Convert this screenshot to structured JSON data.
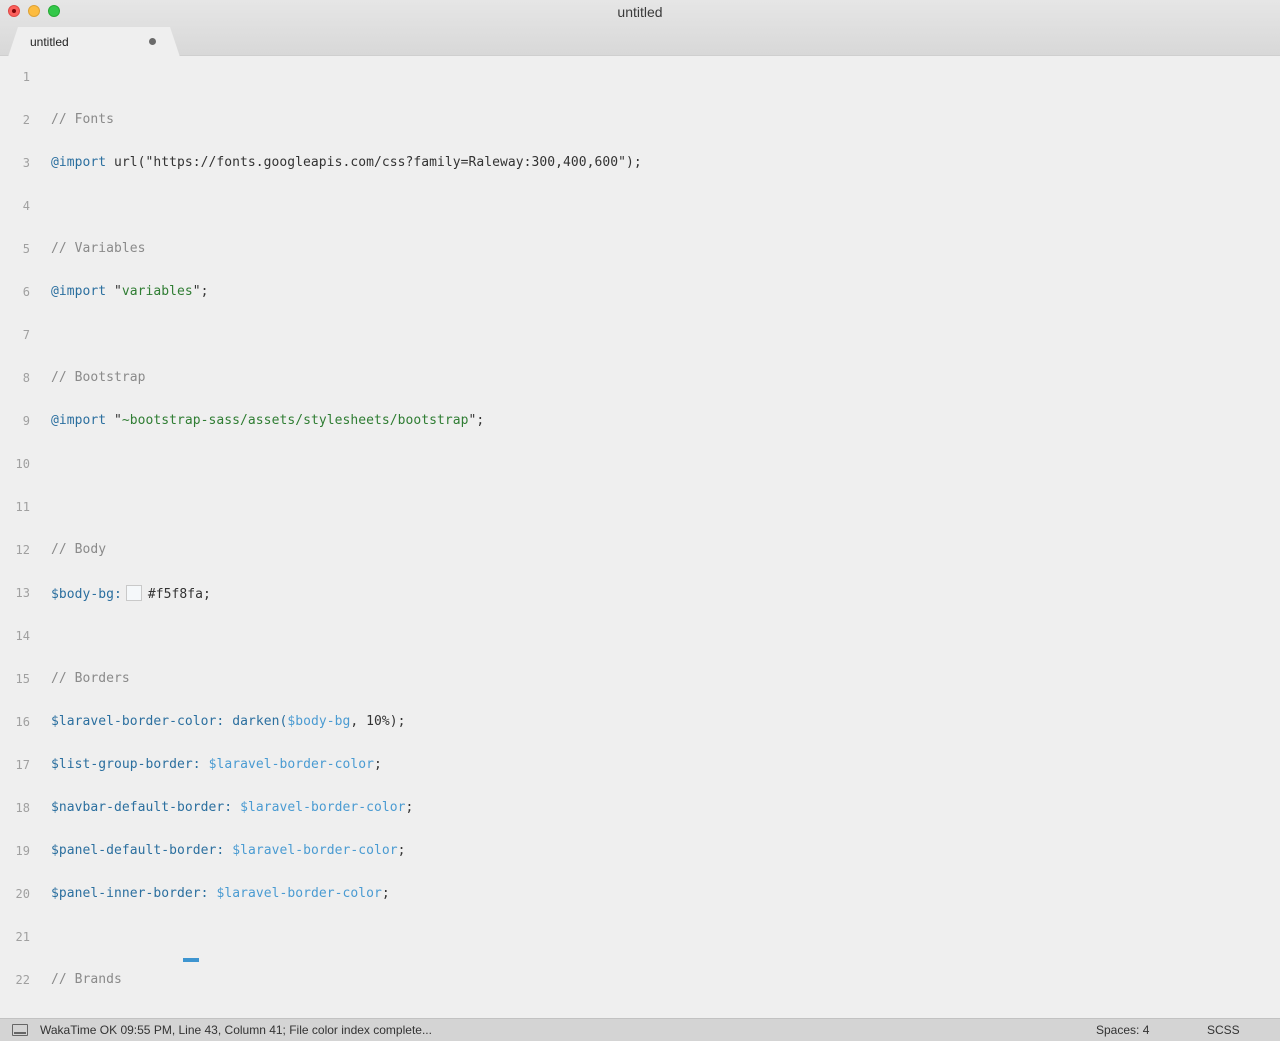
{
  "window": {
    "title": "untitled"
  },
  "tab": {
    "label": "untitled"
  },
  "editor": {
    "lines": [
      {
        "num": "1",
        "tokens": []
      },
      {
        "num": "2",
        "tokens": [
          {
            "t": "comment",
            "v": "// Fonts"
          }
        ]
      },
      {
        "num": "3",
        "tokens": [
          {
            "t": "at",
            "v": "@import"
          },
          {
            "t": "plain",
            "v": " url(\"https://fonts.googleapis.com/css?family=Raleway:300,400,600\");"
          }
        ]
      },
      {
        "num": "4",
        "tokens": []
      },
      {
        "num": "5",
        "tokens": [
          {
            "t": "comment",
            "v": "// Variables"
          }
        ]
      },
      {
        "num": "6",
        "tokens": [
          {
            "t": "at",
            "v": "@import"
          },
          {
            "t": "plain",
            "v": " \""
          },
          {
            "t": "str",
            "v": "variables"
          },
          {
            "t": "plain",
            "v": "\";"
          }
        ]
      },
      {
        "num": "7",
        "tokens": []
      },
      {
        "num": "8",
        "tokens": [
          {
            "t": "comment",
            "v": "// Bootstrap"
          }
        ]
      },
      {
        "num": "9",
        "tokens": [
          {
            "t": "at",
            "v": "@import"
          },
          {
            "t": "plain",
            "v": " \""
          },
          {
            "t": "str",
            "v": "~bootstrap-sass/assets/stylesheets/bootstrap"
          },
          {
            "t": "plain",
            "v": "\";"
          }
        ]
      },
      {
        "num": "10",
        "tokens": []
      },
      {
        "num": "11",
        "tokens": []
      },
      {
        "num": "12",
        "tokens": [
          {
            "t": "comment",
            "v": "// Body"
          }
        ]
      },
      {
        "num": "13",
        "tokens": [
          {
            "t": "var",
            "v": "$body-bg:"
          },
          {
            "t": "swatch",
            "v": "#f5f8fa"
          },
          {
            "t": "plain",
            "v": "#f5f8fa;"
          }
        ]
      },
      {
        "num": "14",
        "tokens": []
      },
      {
        "num": "15",
        "tokens": [
          {
            "t": "comment",
            "v": "// Borders"
          }
        ]
      },
      {
        "num": "16",
        "tokens": [
          {
            "t": "var",
            "v": "$laravel-border-color:"
          },
          {
            "t": "plain",
            "v": " "
          },
          {
            "t": "fn",
            "v": "darken("
          },
          {
            "t": "varref",
            "v": "$body-bg"
          },
          {
            "t": "plain",
            "v": ", 10%);"
          }
        ]
      },
      {
        "num": "17",
        "tokens": [
          {
            "t": "var",
            "v": "$list-group-border:"
          },
          {
            "t": "plain",
            "v": " "
          },
          {
            "t": "varref",
            "v": "$laravel-border-color"
          },
          {
            "t": "plain",
            "v": ";"
          }
        ]
      },
      {
        "num": "18",
        "tokens": [
          {
            "t": "var",
            "v": "$navbar-default-border:"
          },
          {
            "t": "plain",
            "v": " "
          },
          {
            "t": "varref",
            "v": "$laravel-border-color"
          },
          {
            "t": "plain",
            "v": ";"
          }
        ]
      },
      {
        "num": "19",
        "tokens": [
          {
            "t": "var",
            "v": "$panel-default-border:"
          },
          {
            "t": "plain",
            "v": " "
          },
          {
            "t": "varref",
            "v": "$laravel-border-color"
          },
          {
            "t": "plain",
            "v": ";"
          }
        ]
      },
      {
        "num": "20",
        "tokens": [
          {
            "t": "var",
            "v": "$panel-inner-border:"
          },
          {
            "t": "plain",
            "v": " "
          },
          {
            "t": "varref",
            "v": "$laravel-border-color"
          },
          {
            "t": "plain",
            "v": ";"
          }
        ]
      },
      {
        "num": "21",
        "tokens": []
      },
      {
        "num": "22",
        "tokens": [
          {
            "t": "comment",
            "v": "// Brands"
          }
        ]
      }
    ]
  },
  "statusbar": {
    "message": "WakaTime OK 09:55 PM, Line 43, Column 41; File color index complete...",
    "indentation": "Spaces: 4",
    "syntax": "SCSS"
  },
  "colors": {
    "comment": "#8a8a8a",
    "keyword": "#2b6f9f",
    "string": "#2f7d33",
    "variable_ref": "#4a9bd2",
    "background": "#efefef"
  }
}
